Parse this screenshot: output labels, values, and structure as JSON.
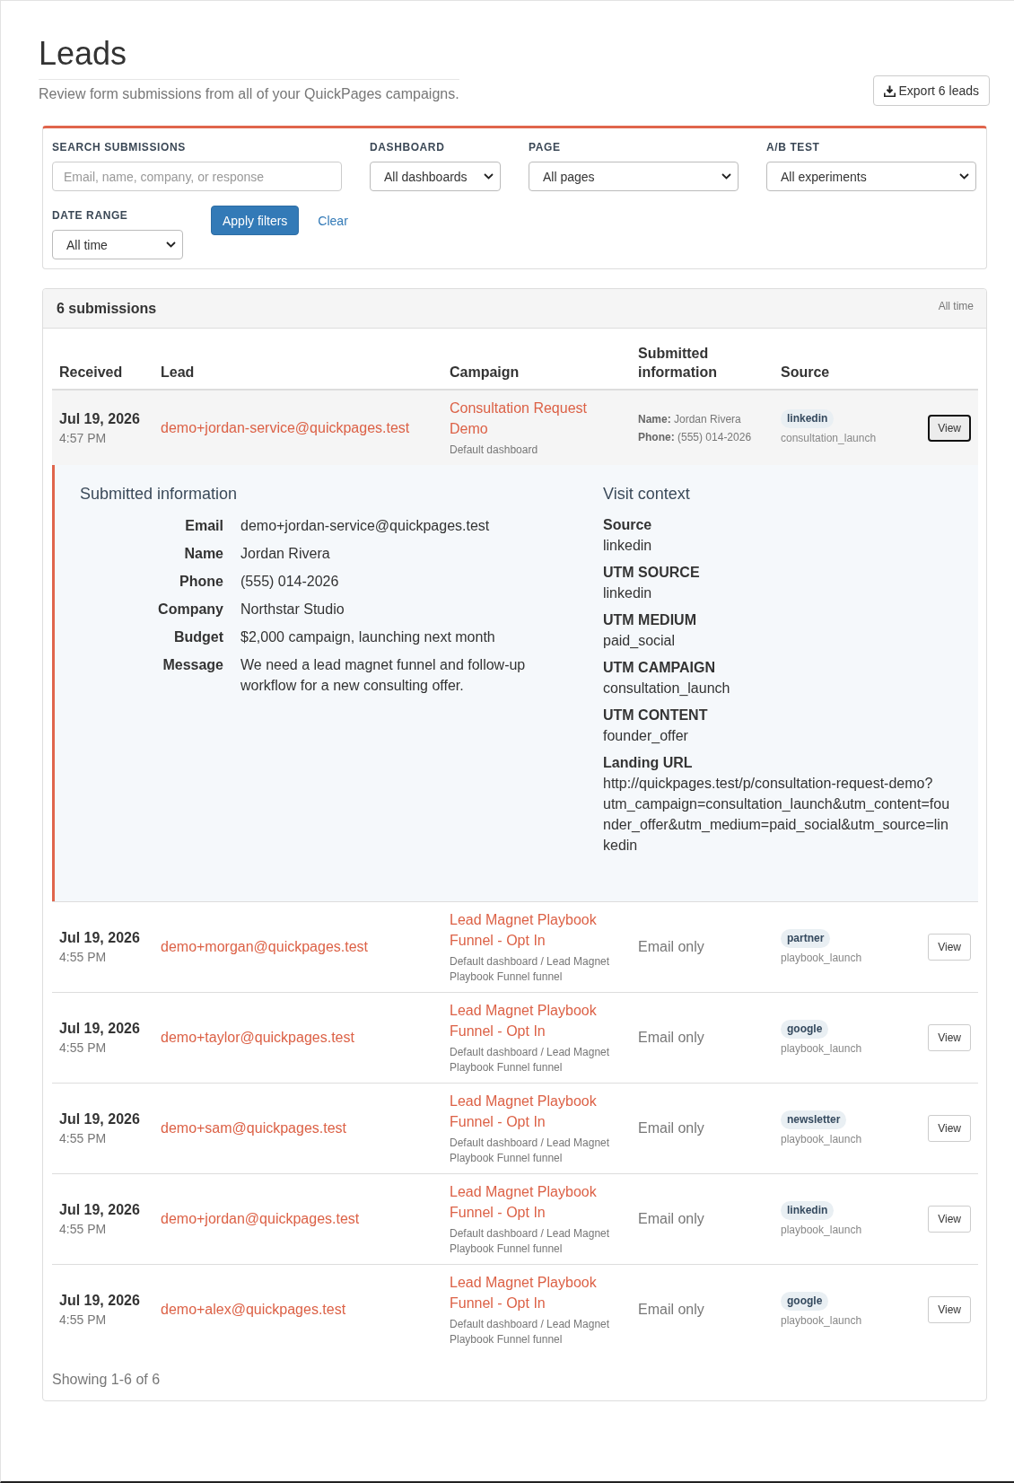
{
  "page": {
    "title": "Leads",
    "subtitle": "Review form submissions from all of your QuickPages campaigns.",
    "export_button": "Export 6 leads"
  },
  "filters": {
    "fields": [
      {
        "kind": "search",
        "label": "SEARCH SUBMISSIONS",
        "placeholder": "Email, name, company, or response"
      },
      {
        "kind": "select",
        "label": "DASHBOARD",
        "value": "All dashboards"
      },
      {
        "kind": "select",
        "label": "PAGE",
        "value": "All pages"
      },
      {
        "kind": "select",
        "label": "A/B TEST",
        "value": "All experiments"
      },
      {
        "kind": "select",
        "label": "DATE RANGE",
        "value": "All time"
      }
    ],
    "apply_button": "Apply filters",
    "clear_link": "Clear"
  },
  "results": {
    "title": "6 submissions",
    "range": "All time",
    "columns": [
      "Received",
      "Lead",
      "Campaign",
      "Submitted information",
      "Source"
    ],
    "rows": [
      {
        "date": "Jul 19, 2026",
        "time": "4:57 PM",
        "lead": "demo+jordan-service@quickpages.test",
        "campaign": "Consultation Request Demo",
        "campaign_path": "Default dashboard",
        "submitted": {
          "kind": "fields",
          "lines": [
            "**Name:** Jordan Rivera",
            "**Phone:** (555) 014-2026"
          ]
        },
        "source": "linkedin",
        "utm_campaign": "consultation_launch",
        "view_button": "View",
        "expanded": true,
        "details": {
          "submitted_title": "Submitted information",
          "fields": [
            {
              "label": "Email",
              "value": "demo+jordan-service@quickpages.test"
            },
            {
              "label": "Name",
              "value": "Jordan Rivera"
            },
            {
              "label": "Phone",
              "value": "(555) 014-2026"
            },
            {
              "label": "Company",
              "value": "Northstar Studio"
            },
            {
              "label": "Budget",
              "value": "$2,000 campaign, launching next month"
            },
            {
              "label": "Message",
              "value": "We need a lead magnet funnel and follow-up workflow for a new consulting offer."
            }
          ],
          "context_title": "Visit context",
          "context": [
            {
              "label": "Source",
              "value": "linkedin"
            },
            {
              "label": "UTM SOURCE",
              "value": "linkedin"
            },
            {
              "label": "UTM MEDIUM",
              "value": "paid_social"
            },
            {
              "label": "UTM CAMPAIGN",
              "value": "consultation_launch"
            },
            {
              "label": "UTM CONTENT",
              "value": "founder_offer"
            },
            {
              "label": "Landing URL",
              "value": "http://quickpages.test/p/consultation-request-demo?utm_campaign=consultation_launch&utm_content=founder_offer&utm_medium=paid_social&utm_source=linkedin"
            }
          ]
        }
      },
      {
        "date": "Jul 19, 2026",
        "time": "4:55 PM",
        "lead": "demo+morgan@quickpages.test",
        "campaign": "Lead Magnet Playbook Funnel - Opt In",
        "campaign_path": "Default dashboard / Lead Magnet Playbook Funnel funnel",
        "submitted": {
          "kind": "summary",
          "text": "Email only"
        },
        "source": "partner",
        "utm_campaign": "playbook_launch",
        "view_button": "View",
        "expanded": false
      },
      {
        "date": "Jul 19, 2026",
        "time": "4:55 PM",
        "lead": "demo+taylor@quickpages.test",
        "campaign": "Lead Magnet Playbook Funnel - Opt In",
        "campaign_path": "Default dashboard / Lead Magnet Playbook Funnel funnel",
        "submitted": {
          "kind": "summary",
          "text": "Email only"
        },
        "source": "google",
        "utm_campaign": "playbook_launch",
        "view_button": "View",
        "expanded": false
      },
      {
        "date": "Jul 19, 2026",
        "time": "4:55 PM",
        "lead": "demo+sam@quickpages.test",
        "campaign": "Lead Magnet Playbook Funnel - Opt In",
        "campaign_path": "Default dashboard / Lead Magnet Playbook Funnel funnel",
        "submitted": {
          "kind": "summary",
          "text": "Email only"
        },
        "source": "newsletter",
        "utm_campaign": "playbook_launch",
        "view_button": "View",
        "expanded": false
      },
      {
        "date": "Jul 19, 2026",
        "time": "4:55 PM",
        "lead": "demo+jordan@quickpages.test",
        "campaign": "Lead Magnet Playbook Funnel - Opt In",
        "campaign_path": "Default dashboard / Lead Magnet Playbook Funnel funnel",
        "submitted": {
          "kind": "summary",
          "text": "Email only"
        },
        "source": "linkedin",
        "utm_campaign": "playbook_launch",
        "view_button": "View",
        "expanded": false
      },
      {
        "date": "Jul 19, 2026",
        "time": "4:55 PM",
        "lead": "demo+alex@quickpages.test",
        "campaign": "Lead Magnet Playbook Funnel - Opt In",
        "campaign_path": "Default dashboard / Lead Magnet Playbook Funnel funnel",
        "submitted": {
          "kind": "summary",
          "text": "Email only"
        },
        "source": "google",
        "utm_campaign": "playbook_launch",
        "view_button": "View",
        "expanded": false
      }
    ],
    "footer": "Showing 1-6 of 6"
  }
}
